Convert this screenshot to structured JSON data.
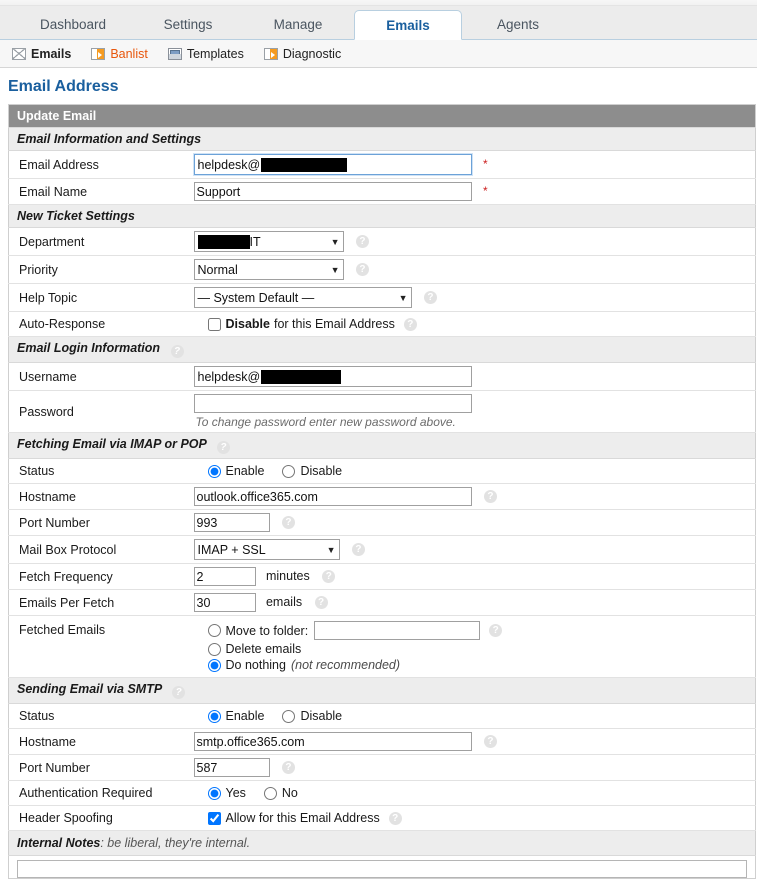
{
  "nav": {
    "tabs": [
      {
        "label": "Dashboard",
        "active": false
      },
      {
        "label": "Settings",
        "active": false
      },
      {
        "label": "Manage",
        "active": false
      },
      {
        "label": "Emails",
        "active": true
      },
      {
        "label": "Agents",
        "active": false
      }
    ],
    "subnav": [
      {
        "label": "Emails",
        "icon": "envelope-icon",
        "style": "current"
      },
      {
        "label": "Banlist",
        "icon": "ban-flag-icon",
        "style": "link"
      },
      {
        "label": "Templates",
        "icon": "template-icon",
        "style": "plain"
      },
      {
        "label": "Diagnostic",
        "icon": "ban-flag-icon",
        "style": "plain"
      }
    ]
  },
  "page": {
    "title": "Email Address",
    "panel_header": "Update Email"
  },
  "sections": {
    "info": "Email Information and Settings",
    "new_ticket": "New Ticket Settings",
    "login": "Email Login Information",
    "fetching": "Fetching Email via IMAP or POP",
    "sending": "Sending Email via SMTP"
  },
  "fields": {
    "email_address": {
      "label": "Email Address",
      "value": "helpdesk@",
      "redacted": true,
      "required": "*"
    },
    "email_name": {
      "label": "Email Name",
      "value": "Support",
      "required": "*"
    },
    "department": {
      "label": "Department",
      "value": "IT",
      "redacted": true
    },
    "priority": {
      "label": "Priority",
      "value": "Normal"
    },
    "help_topic": {
      "label": "Help Topic",
      "value": "— System Default —"
    },
    "auto_response": {
      "label": "Auto-Response",
      "checkbox_bold": "Disable",
      "checkbox_rest": "for this Email Address",
      "checked": false
    },
    "username": {
      "label": "Username",
      "value": "helpdesk@",
      "redacted": true
    },
    "password": {
      "label": "Password",
      "value": "",
      "hint": "To change password enter new password above."
    },
    "imap_status": {
      "label": "Status",
      "enable": "Enable",
      "disable": "Disable",
      "selected": "Enable"
    },
    "imap_hostname": {
      "label": "Hostname",
      "value": "outlook.office365.com"
    },
    "imap_port": {
      "label": "Port Number",
      "value": "993"
    },
    "mailbox_protocol": {
      "label": "Mail Box Protocol",
      "value": "IMAP + SSL"
    },
    "fetch_frequency": {
      "label": "Fetch Frequency",
      "value": "2",
      "unit": "minutes"
    },
    "emails_per_fetch": {
      "label": "Emails Per Fetch",
      "value": "30",
      "unit": "emails"
    },
    "fetched_emails": {
      "label": "Fetched Emails",
      "options": [
        {
          "label": "Move to folder:",
          "selected": false,
          "has_input": true,
          "input_value": ""
        },
        {
          "label": "Delete emails",
          "selected": false,
          "has_input": false
        },
        {
          "label": "Do nothing",
          "note": "(not recommended)",
          "selected": true,
          "has_input": false
        }
      ]
    },
    "smtp_status": {
      "label": "Status",
      "enable": "Enable",
      "disable": "Disable",
      "selected": "Enable"
    },
    "smtp_hostname": {
      "label": "Hostname",
      "value": "smtp.office365.com"
    },
    "smtp_port": {
      "label": "Port Number",
      "value": "587"
    },
    "auth_required": {
      "label": "Authentication Required",
      "yes": "Yes",
      "no": "No",
      "selected": "Yes"
    },
    "header_spoofing": {
      "label": "Header Spoofing",
      "checkbox_text": "Allow for this Email Address",
      "checked": true
    }
  },
  "notes": {
    "title": "Internal Notes",
    "desc": ": be liberal, they're internal."
  },
  "icons": {
    "help": "?"
  },
  "colors": {
    "accent": "#1a5f9e",
    "link": "#e8560c",
    "panel_header_bg": "#8d8d8d",
    "section_bg": "#ededed",
    "required": "#cc2020"
  }
}
